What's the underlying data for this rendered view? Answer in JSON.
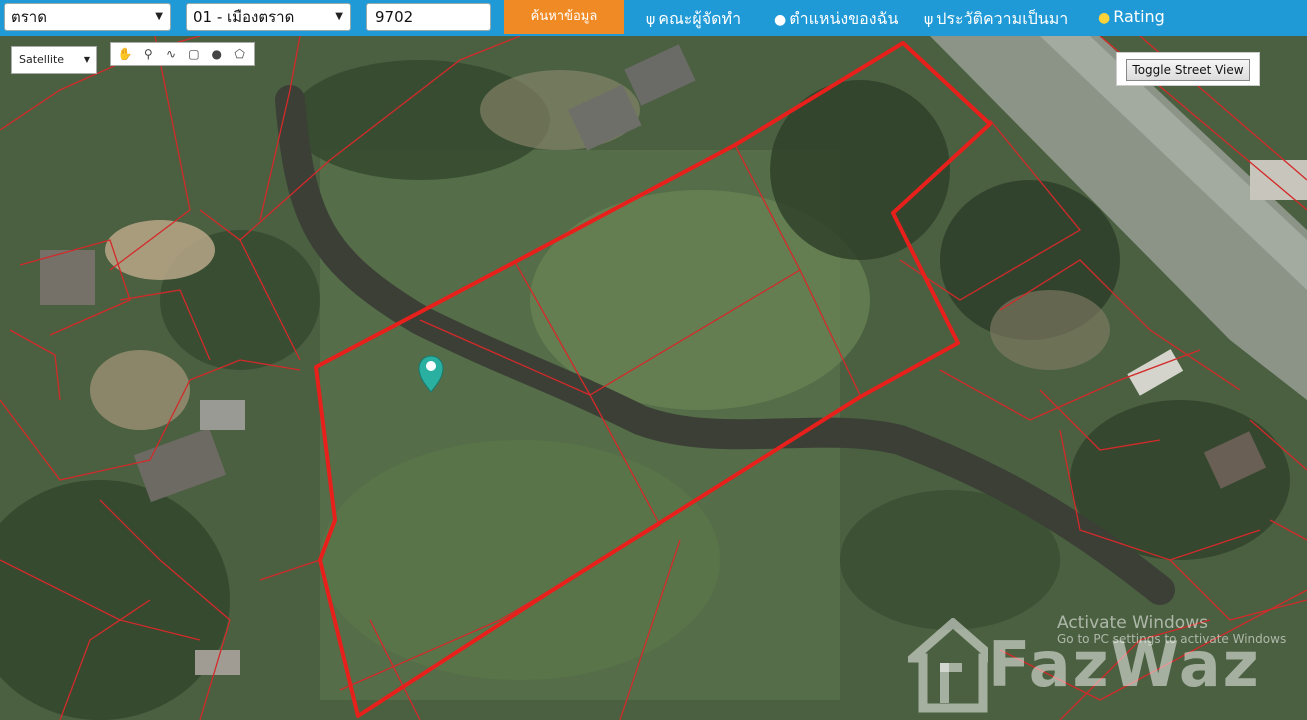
{
  "header": {
    "province_select": "ตราด",
    "district_select": "01 - เมืองตราด",
    "parcel_input": "9702",
    "search_button": "ค้นหาข้อมูล",
    "links": [
      {
        "label": "คณะผู้จัดทำ",
        "icon": "antenna-icon"
      },
      {
        "label": "ตำแหน่งของฉัน",
        "icon": "person-icon"
      },
      {
        "label": "ประวัติความเป็นมา",
        "icon": "antenna-icon"
      },
      {
        "label": "Rating",
        "icon": "star-icon"
      }
    ]
  },
  "map": {
    "map_type": "Satellite",
    "draw_tools": [
      "hand-icon",
      "marker-icon",
      "polyline-icon",
      "rectangle-icon",
      "circle-icon",
      "polygon-icon"
    ],
    "street_view_button": "Toggle Street View",
    "highlight_color": "#e8201c",
    "parcel_line_color": "#d32a2a",
    "marker_color": "#2ab0a0"
  },
  "overlay": {
    "activate_line1": "Activate Windows",
    "activate_line2": "Go to PC settings to activate Windows",
    "logo_text": "FazWaz"
  }
}
